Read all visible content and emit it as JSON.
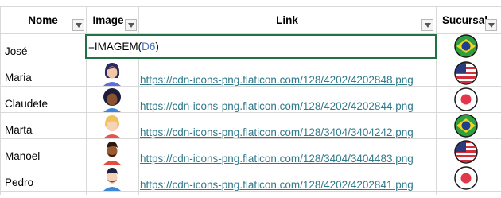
{
  "headers": {
    "nome": "Nome",
    "image": "Image",
    "link": "Link",
    "sucursal": "Sucursal"
  },
  "edit_cell": {
    "prefix": "=IMAGEM(",
    "ref": "D6",
    "suffix": ")"
  },
  "rows": [
    {
      "name": "José",
      "link": "",
      "avatar": "none",
      "flag": "brazil-flag-icon"
    },
    {
      "name": "Maria",
      "link": "https://cdn-icons-png.flaticon.com/128/4202/4202848.png",
      "avatar": "woman-avatar-icon",
      "flag": "usa-flag-icon"
    },
    {
      "name": "Claudete",
      "link": "https://cdn-icons-png.flaticon.com/128/4202/4202844.png",
      "avatar": "woman-avatar-icon",
      "flag": "japan-flag-icon"
    },
    {
      "name": "Marta",
      "link": "https://cdn-icons-png.flaticon.com/128/3404/3404242.png",
      "avatar": "woman-avatar-icon",
      "flag": "brazil-flag-icon"
    },
    {
      "name": "Manoel",
      "link": "https://cdn-icons-png.flaticon.com/128/3404/3404483.png",
      "avatar": "man-avatar-icon",
      "flag": "usa-flag-icon"
    },
    {
      "name": "Pedro",
      "link": "https://cdn-icons-png.flaticon.com/128/4202/4202841.png",
      "avatar": "man-avatar-icon",
      "flag": "japan-flag-icon"
    }
  ],
  "colors": {
    "grid": "#d9d9d9",
    "link": "#2f7a8b",
    "active_cell_border": "#217346"
  }
}
